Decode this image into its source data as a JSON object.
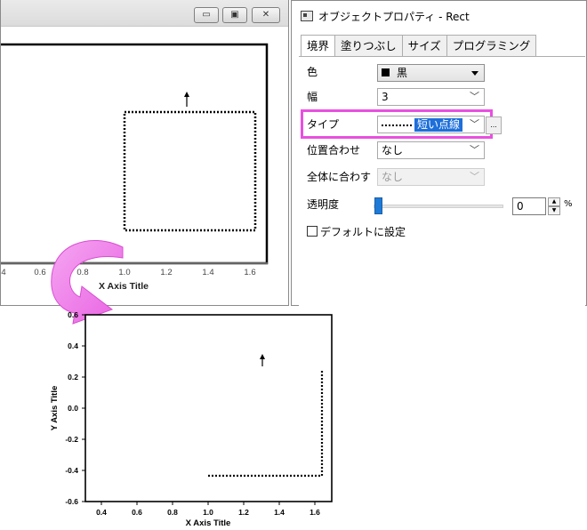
{
  "graph_window": {
    "min_button": "▭",
    "max_button": "▣",
    "close_button": "✕",
    "x_axis_title": "X Axis Title",
    "x_ticks": [
      "0.6",
      "0.8",
      "1.0",
      "1.2",
      "1.4",
      "1.6"
    ],
    "x_tick_partial": "4"
  },
  "dialog": {
    "title": "オブジェクトプロパティ - Rect",
    "tabs": [
      {
        "label": "境界"
      },
      {
        "label": "塗りつぶし"
      },
      {
        "label": "サイズ"
      },
      {
        "label": "プログラミング"
      }
    ],
    "rows": {
      "color_label": "色",
      "color_value": "黒",
      "width_label": "幅",
      "width_value": "3",
      "type_label": "タイプ",
      "type_value": "短い点線",
      "position_label": "位置合わせ",
      "position_value": "なし",
      "fit_label": "全体に合わす",
      "fit_value": "なし",
      "opacity_label": "透明度",
      "opacity_value": "0",
      "opacity_unit": "%",
      "default_label": "デフォルトに設定"
    },
    "button_ellipsis": "..."
  },
  "lower_graph": {
    "y_axis_title": "Y Axis Title",
    "x_axis_title": "X Axis Title",
    "y_ticks": [
      "0.6",
      "0.4",
      "0.2",
      "0.0",
      "-0.2",
      "-0.4",
      "-0.6"
    ],
    "x_ticks": [
      "0.4",
      "0.6",
      "0.8",
      "1.0",
      "1.2",
      "1.4",
      "1.6"
    ]
  },
  "colors": {
    "highlight": "#e94fe0",
    "arrow": "#f086ec",
    "selection": "#1e6fd9"
  }
}
